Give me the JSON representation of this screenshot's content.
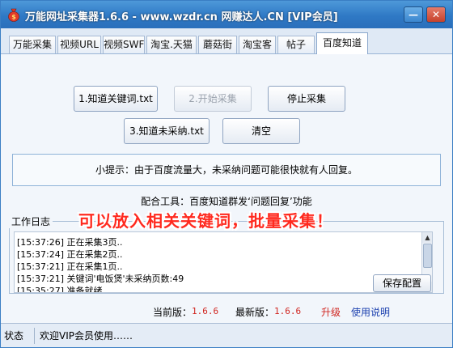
{
  "window": {
    "title": "万能网址采集器1.6.6 - www.wzdr.cn 网赚达人.CN [VIP会员]",
    "minimize_glyph": "—",
    "close_glyph": "✕"
  },
  "tabs": [
    {
      "label": "万能采集",
      "active": false
    },
    {
      "label": "视频URL",
      "active": false
    },
    {
      "label": "视频SWF",
      "active": false
    },
    {
      "label": "淘宝.天猫",
      "active": false
    },
    {
      "label": "蘑菇街",
      "active": false
    },
    {
      "label": "淘宝客",
      "active": false
    },
    {
      "label": "帖子",
      "active": false
    },
    {
      "label": "百度知道",
      "active": true
    }
  ],
  "buttons": {
    "keywords": "1.知道关键词.txt",
    "start": "2.开始采集",
    "stop": "停止采集",
    "uncollected": "3.知道未采纳.txt",
    "clear": "清空"
  },
  "hint": "小提示：由于百度流量大，未采纳问题可能很快就有人回复。",
  "tools": "配合工具：百度知道群发‘问题回复’功能",
  "log": {
    "title": "工作日志",
    "lines": [
      "[15:37:26] 正在采集3页..",
      "[15:37:24] 正在采集2页..",
      "[15:37:21] 正在采集1页..",
      "[15:37:21] 关键词'电饭煲'未采纳页数:49",
      "[15:35:27] 准备就绪......"
    ],
    "save_label": "保存配置"
  },
  "banner": "可以放入相关关键词，批量采集！",
  "versions": {
    "current_label": "当前版：",
    "current_value": "1.6.6",
    "latest_label": "最新版：",
    "latest_value": "1.6.6",
    "upgrade": "升级",
    "help": "使用说明"
  },
  "status": {
    "label": "状态",
    "text": "欢迎VIP会员使用……"
  },
  "colors": {
    "titlebar": "#2f79c5",
    "banner_red": "#ff2a1f",
    "version_red": "#d0251f",
    "link_blue": "#1a3fae"
  }
}
